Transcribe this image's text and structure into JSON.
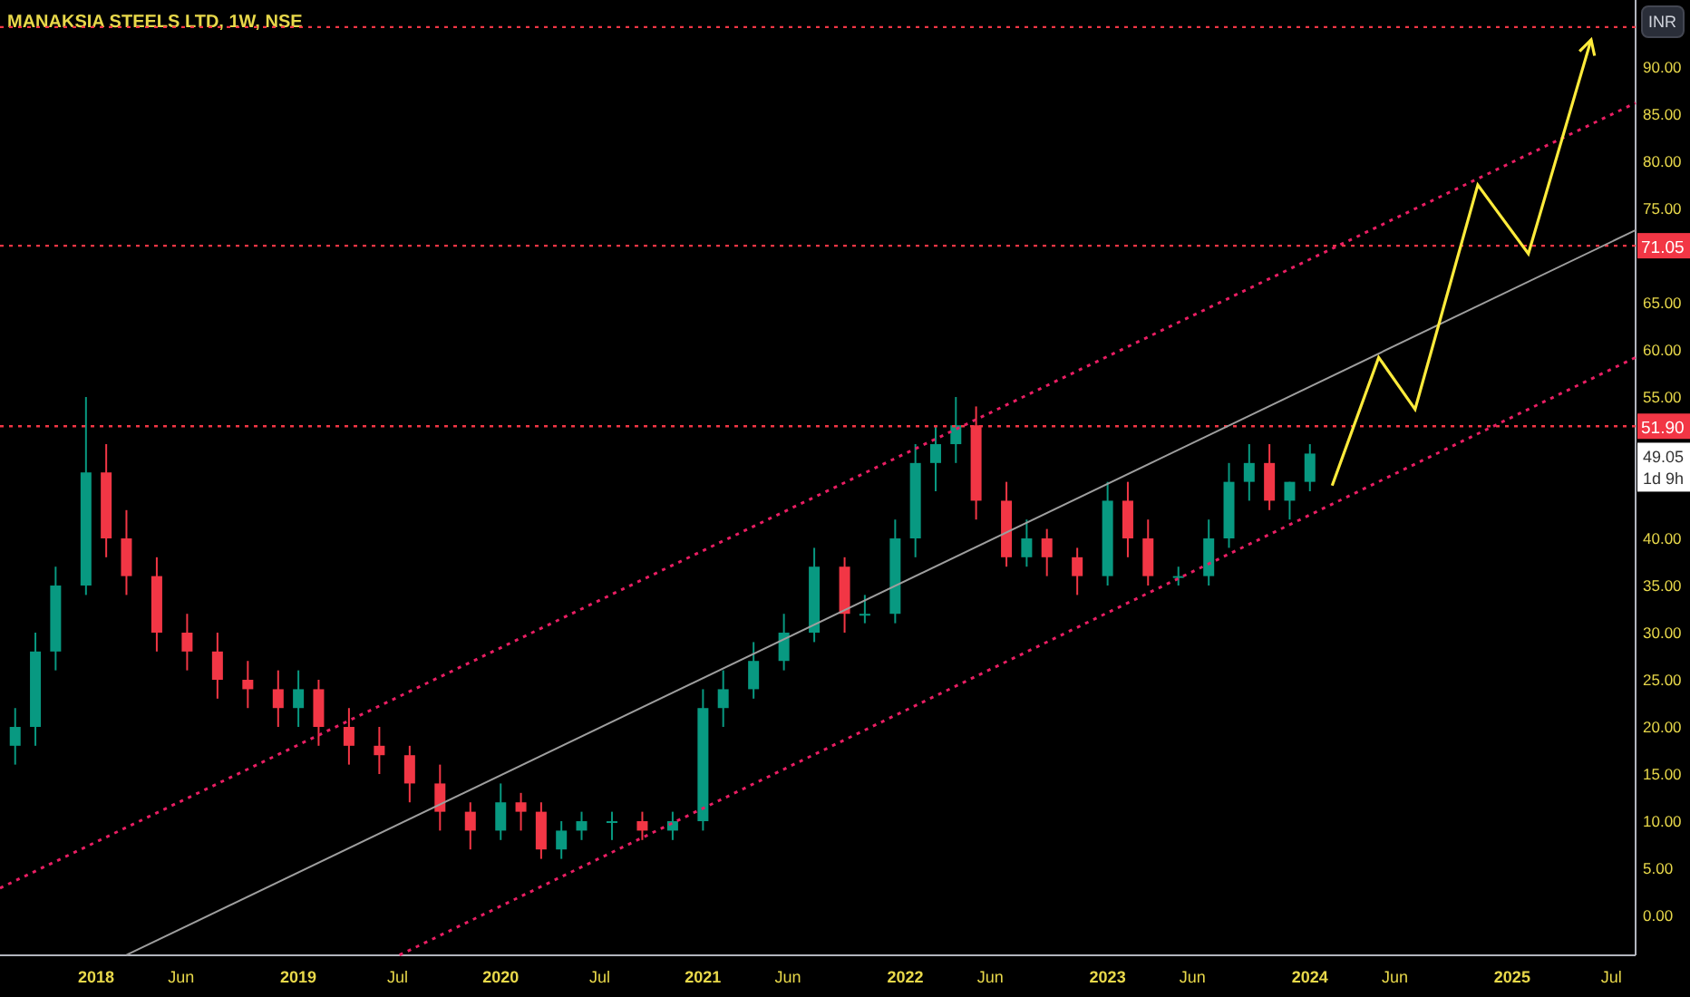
{
  "title": "MANAKSIA STEELS LTD, 1W, NSE",
  "currency_button": "INR",
  "current_price": {
    "value": "49.05",
    "countdown": "1d 9h"
  },
  "price_labels": [
    "71.05",
    "51.90"
  ],
  "chart_data": {
    "type": "candlestick",
    "xlim": [
      2017.525,
      2025.61
    ],
    "ylim": [
      -4.23,
      97.12
    ],
    "xticks": [
      {
        "value": 2018,
        "label": "2018"
      },
      {
        "value": 2018.42,
        "label": "Jun"
      },
      {
        "value": 2019,
        "label": "2019"
      },
      {
        "value": 2019.49,
        "label": "Jul"
      },
      {
        "value": 2020,
        "label": "2020"
      },
      {
        "value": 2020.49,
        "label": "Jul"
      },
      {
        "value": 2021,
        "label": "2021"
      },
      {
        "value": 2021.42,
        "label": "Jun"
      },
      {
        "value": 2022,
        "label": "2022"
      },
      {
        "value": 2022.42,
        "label": "Jun"
      },
      {
        "value": 2023,
        "label": "2023"
      },
      {
        "value": 2023.42,
        "label": "Jun"
      },
      {
        "value": 2024,
        "label": "2024"
      },
      {
        "value": 2024.42,
        "label": "Jun"
      },
      {
        "value": 2025,
        "label": "2025"
      },
      {
        "value": 2025.49,
        "label": "Jul"
      }
    ],
    "yticks": [
      {
        "value": 0,
        "label": "0.00"
      },
      {
        "value": 5,
        "label": "5.00"
      },
      {
        "value": 10,
        "label": "10.00"
      },
      {
        "value": 15,
        "label": "15.00"
      },
      {
        "value": 20,
        "label": "20.00"
      },
      {
        "value": 25,
        "label": "25.00"
      },
      {
        "value": 30,
        "label": "30.00"
      },
      {
        "value": 35,
        "label": "35.00"
      },
      {
        "value": 40,
        "label": "40.00"
      },
      {
        "value": 55,
        "label": "55.00"
      },
      {
        "value": 60,
        "label": "60.00"
      },
      {
        "value": 65,
        "label": "65.00"
      },
      {
        "value": 75,
        "label": "75.00"
      },
      {
        "value": 80,
        "label": "80.00"
      },
      {
        "value": 85,
        "label": "85.00"
      },
      {
        "value": 90,
        "label": "90.00"
      }
    ],
    "x": [
      2017.6,
      2017.7,
      2017.8,
      2017.95,
      2018.05,
      2018.15,
      2018.3,
      2018.45,
      2018.6,
      2018.75,
      2018.9,
      2019.0,
      2019.1,
      2019.25,
      2019.4,
      2019.55,
      2019.7,
      2019.85,
      2020.0,
      2020.1,
      2020.2,
      2020.3,
      2020.4,
      2020.55,
      2020.7,
      2020.85,
      2021.0,
      2021.1,
      2021.25,
      2021.4,
      2021.55,
      2021.7,
      2021.8,
      2021.95,
      2022.05,
      2022.15,
      2022.25,
      2022.35,
      2022.5,
      2022.6,
      2022.7,
      2022.85,
      2023.0,
      2023.1,
      2023.2,
      2023.35,
      2023.5,
      2023.6,
      2023.7,
      2023.8,
      2023.9,
      2024.0
    ],
    "ohlc": [
      [
        18,
        22,
        16,
        20
      ],
      [
        20,
        30,
        18,
        28
      ],
      [
        28,
        37,
        26,
        35
      ],
      [
        35,
        55,
        34,
        47
      ],
      [
        47,
        50,
        38,
        40
      ],
      [
        40,
        43,
        34,
        36
      ],
      [
        36,
        38,
        28,
        30
      ],
      [
        30,
        32,
        26,
        28
      ],
      [
        28,
        30,
        23,
        25
      ],
      [
        25,
        27,
        22,
        24
      ],
      [
        24,
        26,
        20,
        22
      ],
      [
        22,
        26,
        20,
        24
      ],
      [
        24,
        25,
        18,
        20
      ],
      [
        20,
        22,
        16,
        18
      ],
      [
        18,
        20,
        15,
        17
      ],
      [
        17,
        18,
        12,
        14
      ],
      [
        14,
        16,
        9,
        11
      ],
      [
        11,
        12,
        7,
        9
      ],
      [
        9,
        14,
        8,
        12
      ],
      [
        12,
        13,
        9,
        11
      ],
      [
        11,
        12,
        6,
        7
      ],
      [
        7,
        10,
        6,
        9
      ],
      [
        9,
        11,
        8,
        10
      ],
      [
        10,
        11,
        8,
        10
      ],
      [
        10,
        11,
        8,
        9
      ],
      [
        9,
        11,
        8,
        10
      ],
      [
        10,
        24,
        9,
        22
      ],
      [
        22,
        26,
        20,
        24
      ],
      [
        24,
        29,
        23,
        27
      ],
      [
        27,
        32,
        26,
        30
      ],
      [
        30,
        39,
        29,
        37
      ],
      [
        37,
        38,
        30,
        32
      ],
      [
        32,
        34,
        31,
        32
      ],
      [
        32,
        42,
        31,
        40
      ],
      [
        40,
        50,
        38,
        48
      ],
      [
        48,
        52,
        45,
        50
      ],
      [
        50,
        55,
        48,
        52
      ],
      [
        52,
        54,
        42,
        44
      ],
      [
        44,
        46,
        37,
        38
      ],
      [
        38,
        42,
        37,
        40
      ],
      [
        40,
        41,
        36,
        38
      ],
      [
        38,
        39,
        34,
        36
      ],
      [
        36,
        46,
        35,
        44
      ],
      [
        44,
        46,
        38,
        40
      ],
      [
        40,
        42,
        35,
        36
      ],
      [
        36,
        37,
        35,
        36
      ],
      [
        36,
        42,
        35,
        40
      ],
      [
        40,
        48,
        39,
        46
      ],
      [
        46,
        50,
        44,
        48
      ],
      [
        48,
        50,
        43,
        44
      ],
      [
        44,
        46,
        42,
        46
      ],
      [
        46,
        50,
        45,
        49
      ]
    ]
  }
}
